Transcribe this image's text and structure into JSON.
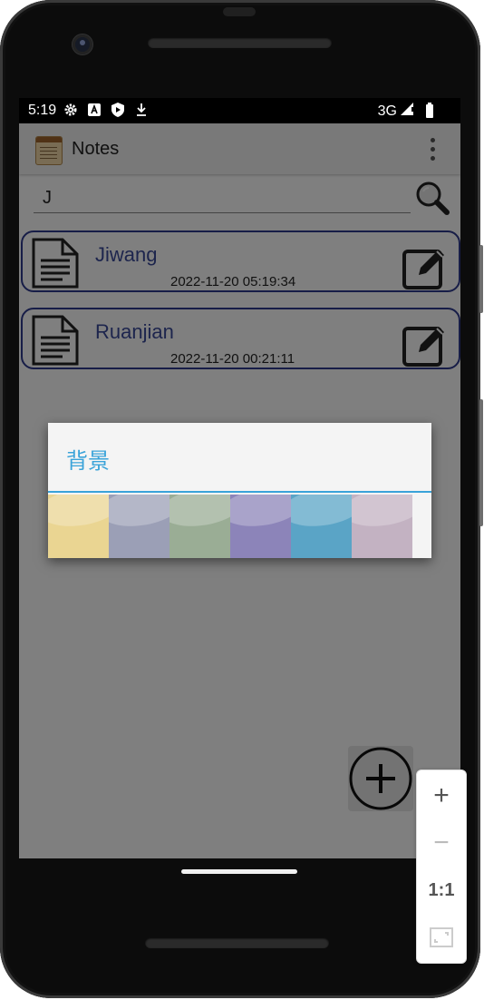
{
  "status_bar": {
    "time": "5:19",
    "network": "3G",
    "icons": [
      "gear-icon",
      "a-notification-icon",
      "shield-icon",
      "download-icon",
      "signal-icon",
      "battery-icon"
    ]
  },
  "app_bar": {
    "title": "Notes",
    "icon": "notepad-icon",
    "menu_icon": "overflow-menu-icon"
  },
  "search": {
    "value": "J",
    "button_icon": "search-icon"
  },
  "notes": [
    {
      "title": "Jiwang",
      "timestamp": "2022-11-20 05:19:34"
    },
    {
      "title": "Ruanjian",
      "timestamp": "2022-11-20 00:21:11"
    }
  ],
  "fab": {
    "icon": "add-circle-icon"
  },
  "dialog": {
    "title": "背景",
    "swatches": [
      {
        "name": "yellow",
        "color": "#ead592"
      },
      {
        "name": "grey-blue",
        "color": "#9b9fb6"
      },
      {
        "name": "green",
        "color": "#9aad95"
      },
      {
        "name": "purple",
        "color": "#8c84b9"
      },
      {
        "name": "blue",
        "color": "#5aa4c6"
      },
      {
        "name": "pink",
        "color": "#c3b2c2"
      }
    ],
    "accent": "#3aa3d9"
  },
  "colors": {
    "card_border": "#2f3a8f",
    "note_title": "#3b4a9a"
  },
  "zoom_controls": {
    "zoom_in": "+",
    "zoom_out": "−",
    "actual_size": "1:1",
    "fit_icon": "fit-screen-icon"
  }
}
